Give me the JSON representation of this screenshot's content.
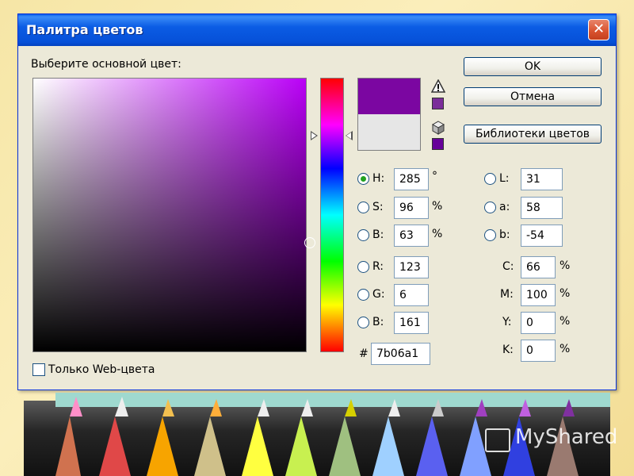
{
  "window": {
    "title": "Палитра цветов",
    "close_glyph": "✕"
  },
  "picker": {
    "prompt": "Выберите основной цвет:",
    "current_color": "#7b06a1",
    "previous_color": "#e6e6e6",
    "hue_color": "#ba00f7"
  },
  "buttons": {
    "ok": "OK",
    "cancel": "Отмена",
    "libraries": "Библиотеки цветов"
  },
  "hsb": {
    "h": {
      "label": "H:",
      "value": "285",
      "unit": "°",
      "selected": true
    },
    "s": {
      "label": "S:",
      "value": "96",
      "unit": "%"
    },
    "b": {
      "label": "B:",
      "value": "63",
      "unit": "%"
    }
  },
  "rgb": {
    "r": {
      "label": "R:",
      "value": "123"
    },
    "g": {
      "label": "G:",
      "value": "6"
    },
    "b": {
      "label": "B:",
      "value": "161"
    }
  },
  "hex": {
    "label": "#",
    "value": "7b06a1"
  },
  "lab": {
    "l": {
      "label": "L:",
      "value": "31"
    },
    "a": {
      "label": "a:",
      "value": "58"
    },
    "b": {
      "label": "b:",
      "value": "-54"
    }
  },
  "cmyk": {
    "c": {
      "label": "C:",
      "value": "66",
      "unit": "%"
    },
    "m": {
      "label": "M:",
      "value": "100",
      "unit": "%"
    },
    "y": {
      "label": "Y:",
      "value": "0",
      "unit": "%"
    },
    "k": {
      "label": "K:",
      "value": "0",
      "unit": "%"
    }
  },
  "web_only": {
    "label": "Только Web-цвета",
    "checked": false
  },
  "icons": {
    "gamut_warning": "warning-triangle-icon",
    "web_safe": "cube-icon"
  },
  "warning_swatch": "#7b2d9a",
  "websafe_swatch": "#660099",
  "watermark": "MyShared"
}
